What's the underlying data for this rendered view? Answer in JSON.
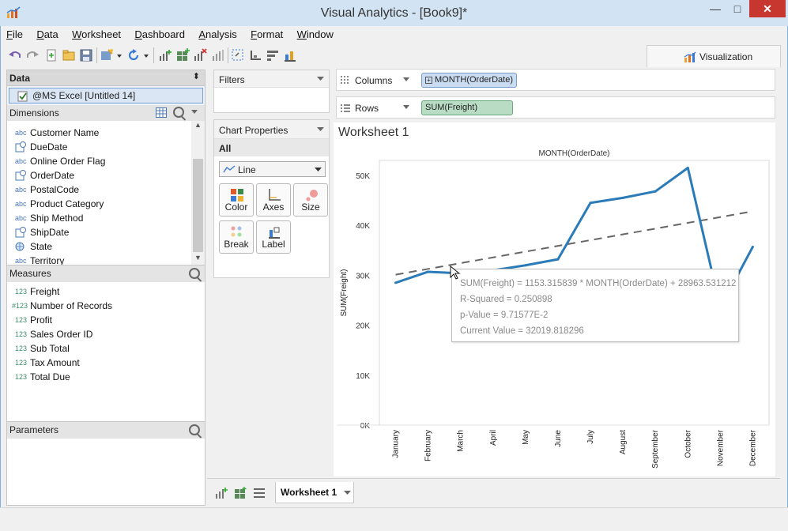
{
  "window": {
    "title": "Visual Analytics - [Book9]*",
    "close_label": "✕",
    "max_label": "□",
    "min_label": "—"
  },
  "menu": [
    {
      "label": "File"
    },
    {
      "label": "Data"
    },
    {
      "label": "Worksheet"
    },
    {
      "label": "Dashboard"
    },
    {
      "label": "Analysis"
    },
    {
      "label": "Format"
    },
    {
      "label": "Window"
    }
  ],
  "visualization_tab": {
    "label": "Visualization"
  },
  "data_panel": {
    "title": "Data",
    "source": "@MS Excel [Untitled 14]",
    "dimensions_label": "Dimensions",
    "dimensions": [
      {
        "icon": "abc",
        "label": "Customer Name"
      },
      {
        "icon": "date",
        "label": "DueDate"
      },
      {
        "icon": "abc",
        "label": "Online Order Flag"
      },
      {
        "icon": "date",
        "label": "OrderDate"
      },
      {
        "icon": "abc",
        "label": "PostalCode"
      },
      {
        "icon": "abc",
        "label": "Product Category"
      },
      {
        "icon": "abc",
        "label": "Ship Method"
      },
      {
        "icon": "date",
        "label": "ShipDate"
      },
      {
        "icon": "globe",
        "label": "State"
      },
      {
        "icon": "abc",
        "label": "Territory"
      }
    ],
    "measures_label": "Measures",
    "measures": [
      {
        "icon": "123",
        "label": "Freight"
      },
      {
        "icon": "#123",
        "label": "Number of Records"
      },
      {
        "icon": "123",
        "label": "Profit"
      },
      {
        "icon": "123",
        "label": "Sales Order ID"
      },
      {
        "icon": "123",
        "label": "Sub Total"
      },
      {
        "icon": "123",
        "label": "Tax Amount"
      },
      {
        "icon": "123",
        "label": "Total Due"
      }
    ],
    "parameters_label": "Parameters"
  },
  "filters": {
    "title": "Filters"
  },
  "chart_properties": {
    "title": "Chart Properties",
    "scope": "All",
    "mark_type": "Line",
    "buttons": [
      {
        "label": "Color"
      },
      {
        "label": "Axes"
      },
      {
        "label": "Size"
      },
      {
        "label": "Break"
      },
      {
        "label": "Label"
      }
    ]
  },
  "shelves": {
    "columns_label": "Columns",
    "columns_pill": "MONTH(OrderDate)",
    "rows_label": "Rows",
    "rows_pill": "SUM(Freight)"
  },
  "worksheet": {
    "title": "Worksheet 1"
  },
  "tooltip": {
    "line1": "SUM(Freight) = 1153.315839 * MONTH(OrderDate) + 28963.531212",
    "line2": "R-Squared = 0.250898",
    "line3": "p-Value = 9.71577E-2",
    "line4": "Current Value = 32019.818296"
  },
  "bottom_tabs": {
    "active": "Worksheet 1"
  },
  "colors": {
    "line": "#2b7bb9",
    "trend": "#666666",
    "columns_pill": "#c9dcf2",
    "rows_pill": "#b8dcc4"
  },
  "chart_data": {
    "type": "line",
    "title": "MONTH(OrderDate)",
    "xlabel": "",
    "ylabel": "SUM(Freight)",
    "categories": [
      "January",
      "February",
      "March",
      "April",
      "May",
      "June",
      "July",
      "August",
      "September",
      "October",
      "November",
      "December"
    ],
    "series": [
      {
        "values": [
          28500,
          30700,
          30400,
          31000,
          32000,
          33200,
          44500,
          45500,
          46800,
          51500,
          23500,
          35700
        ]
      }
    ],
    "trend_line": {
      "slope": 1153.315839,
      "intercept": 28963.531212
    },
    "y_ticks": [
      "0K",
      "10K",
      "20K",
      "30K",
      "40K",
      "50K"
    ],
    "ylim": [
      0,
      53000
    ],
    "grid": false
  }
}
